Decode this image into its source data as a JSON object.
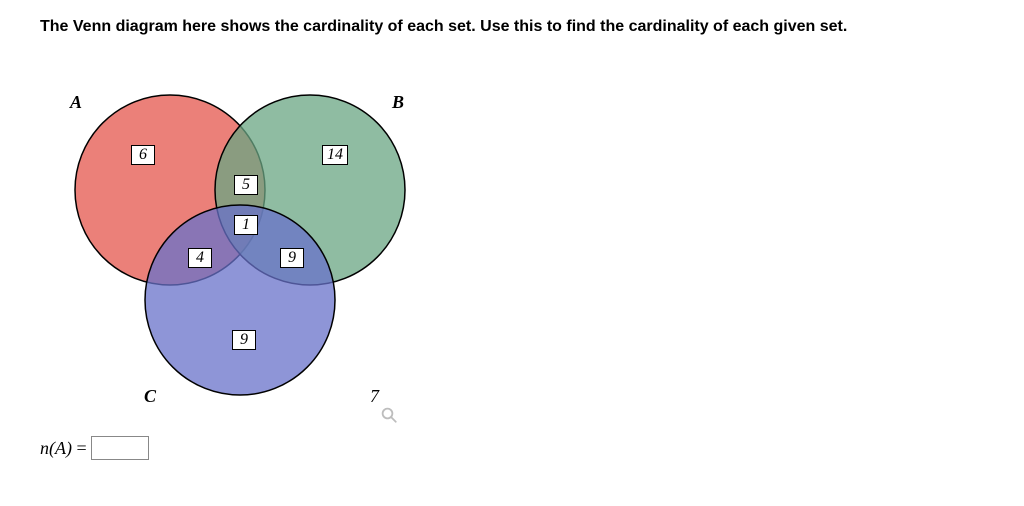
{
  "instruction": "The Venn diagram here shows the cardinality of each set. Use this to find the cardinality of each given set.",
  "labels": {
    "A": "A",
    "B": "B",
    "C": "C"
  },
  "regions": {
    "A_only": "6",
    "B_only": "14",
    "C_only": "9",
    "AB": "5",
    "AC": "4",
    "BC": "9",
    "ABC": "1",
    "outside": "7"
  },
  "question": {
    "prefix": "n(A)",
    "equals": " = ",
    "value": ""
  },
  "chart_data": {
    "type": "venn3",
    "sets": [
      "A",
      "B",
      "C"
    ],
    "region_cardinalities": {
      "A_only": 6,
      "B_only": 14,
      "C_only": 9,
      "A_int_B_only": 5,
      "A_int_C_only": 4,
      "B_int_C_only": 9,
      "A_int_B_int_C": 1,
      "outside_all": 7
    },
    "colors": {
      "A": "#e86a62",
      "B": "#6aa583",
      "C": "#6871c9"
    },
    "question": "n(A)"
  }
}
